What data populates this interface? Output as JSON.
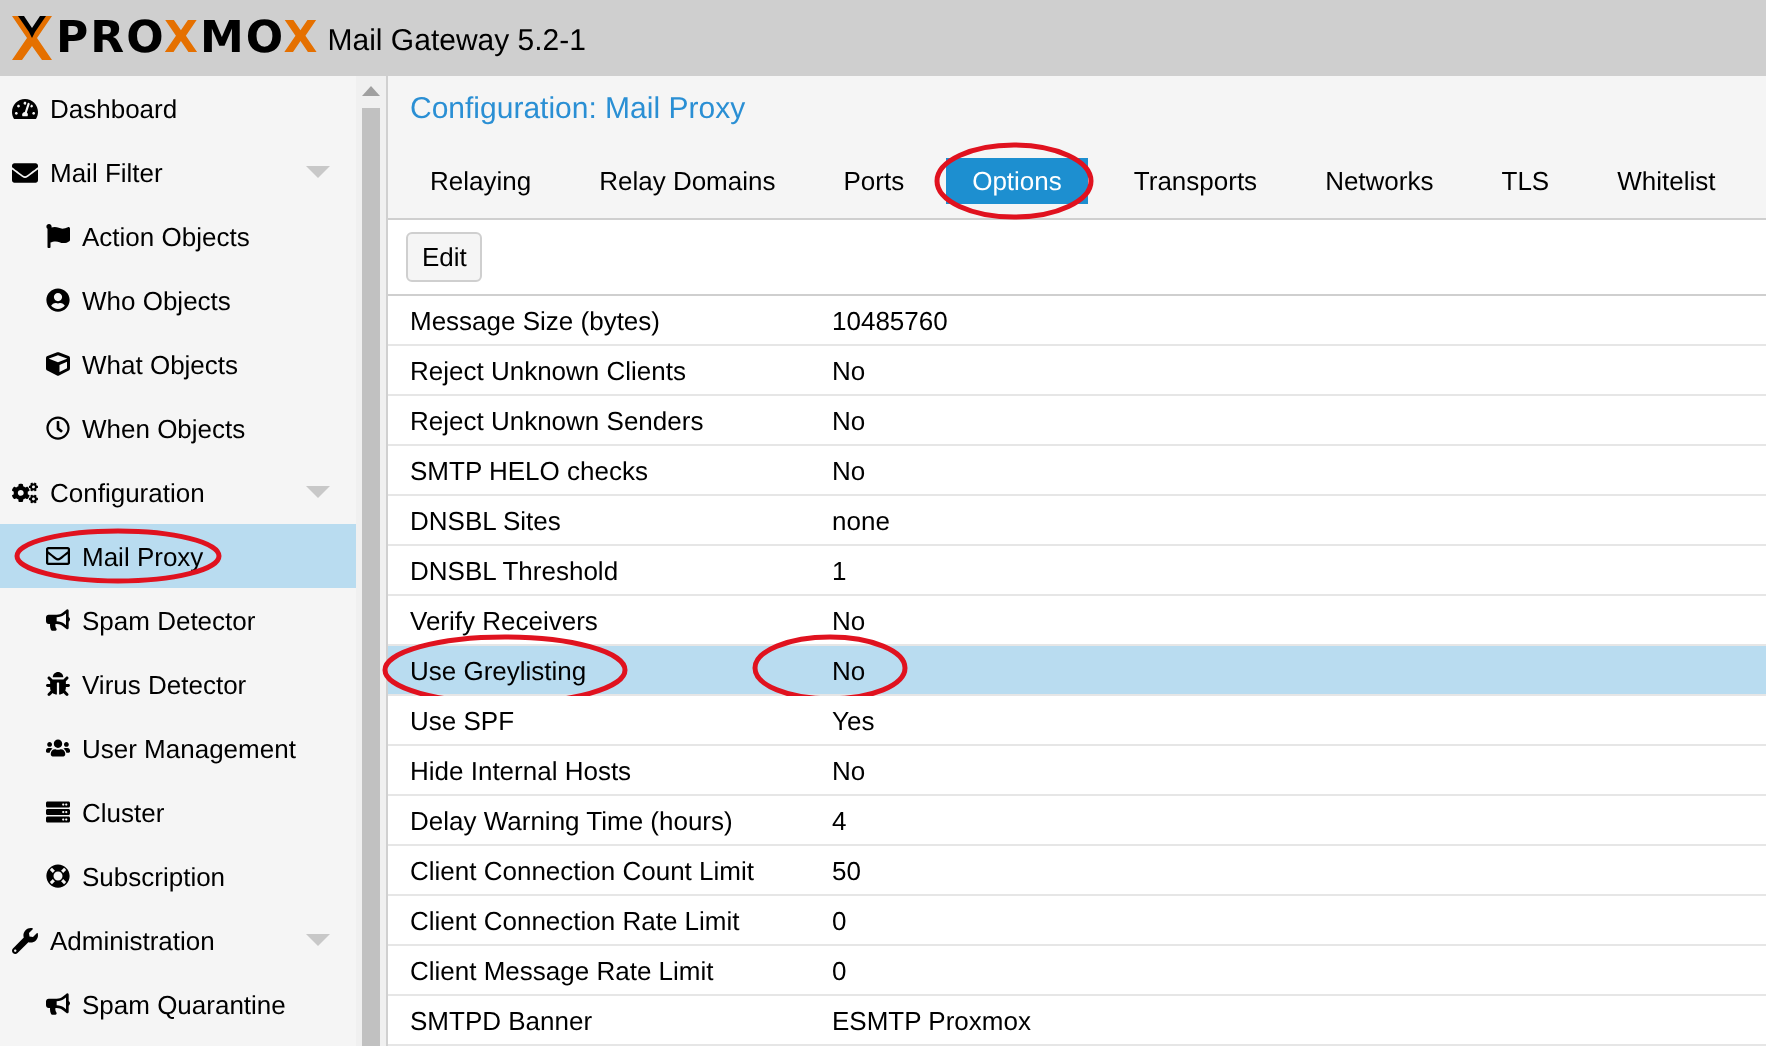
{
  "header": {
    "logo": "PROXMOX",
    "product": "Mail Gateway 5.2-1"
  },
  "sidebar": {
    "items": [
      {
        "label": "Dashboard",
        "selected": false,
        "circled": false
      },
      {
        "label": "Mail Filter",
        "selected": false,
        "circled": false,
        "children": [
          {
            "label": "Action Objects",
            "selected": false,
            "circled": false
          },
          {
            "label": "Who Objects",
            "selected": false,
            "circled": false
          },
          {
            "label": "What Objects",
            "selected": false,
            "circled": false
          },
          {
            "label": "When Objects",
            "selected": false,
            "circled": false
          }
        ]
      },
      {
        "label": "Configuration",
        "selected": false,
        "circled": false,
        "children": [
          {
            "label": "Mail Proxy",
            "selected": true,
            "circled": true
          },
          {
            "label": "Spam Detector",
            "selected": false,
            "circled": false
          },
          {
            "label": "Virus Detector",
            "selected": false,
            "circled": false
          },
          {
            "label": "User Management",
            "selected": false,
            "circled": false
          },
          {
            "label": "Cluster",
            "selected": false,
            "circled": false
          },
          {
            "label": "Subscription",
            "selected": false,
            "circled": false
          }
        ]
      },
      {
        "label": "Administration",
        "selected": false,
        "circled": false,
        "children": [
          {
            "label": "Spam Quarantine",
            "selected": false,
            "circled": false
          }
        ]
      }
    ]
  },
  "panel": {
    "title": "Configuration: Mail Proxy",
    "tabs": [
      {
        "label": "Relaying",
        "selected": false,
        "circled": false
      },
      {
        "label": "Relay Domains",
        "selected": false,
        "circled": false
      },
      {
        "label": "Ports",
        "selected": false,
        "circled": false
      },
      {
        "label": "Options",
        "selected": true,
        "circled": true
      },
      {
        "label": "Transports",
        "selected": false,
        "circled": false
      },
      {
        "label": "Networks",
        "selected": false,
        "circled": false
      },
      {
        "label": "TLS",
        "selected": false,
        "circled": false
      },
      {
        "label": "Whitelist",
        "selected": false,
        "circled": false
      }
    ],
    "toolbar": {
      "button": "Edit"
    },
    "rows": [
      {
        "name": "Message Size (bytes)",
        "value": "10485760",
        "selected": false,
        "circled": false
      },
      {
        "name": "Reject Unknown Clients",
        "value": "No",
        "selected": false,
        "circled": false
      },
      {
        "name": "Reject Unknown Senders",
        "value": "No",
        "selected": false,
        "circled": false
      },
      {
        "name": "SMTP HELO checks",
        "value": "No",
        "selected": false,
        "circled": false
      },
      {
        "name": "DNSBL Sites",
        "value": "none",
        "selected": false,
        "circled": false
      },
      {
        "name": "DNSBL Threshold",
        "value": "1",
        "selected": false,
        "circled": false
      },
      {
        "name": "Verify Receivers",
        "value": "No",
        "selected": false,
        "circled": false
      },
      {
        "name": "Use Greylisting",
        "value": "No",
        "selected": true,
        "circled": true
      },
      {
        "name": "Use SPF",
        "value": "Yes",
        "selected": false,
        "circled": false
      },
      {
        "name": "Hide Internal Hosts",
        "value": "No",
        "selected": false,
        "circled": false
      },
      {
        "name": "Delay Warning Time (hours)",
        "value": "4",
        "selected": false,
        "circled": false
      },
      {
        "name": "Client Connection Count Limit",
        "value": "50",
        "selected": false,
        "circled": false
      },
      {
        "name": "Client Connection Rate Limit",
        "value": "0",
        "selected": false,
        "circled": false
      },
      {
        "name": "Client Message Rate Limit",
        "value": "0",
        "selected": false,
        "circled": false
      },
      {
        "name": "SMTPD Banner",
        "value": "ESMTP Proxmox",
        "selected": false,
        "circled": false
      }
    ]
  }
}
